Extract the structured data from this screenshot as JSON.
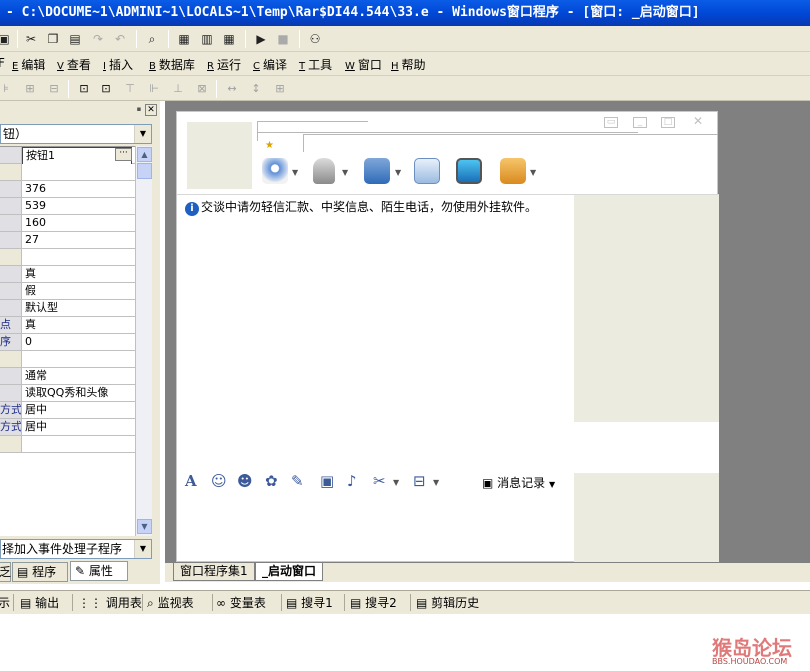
{
  "window": {
    "title": "- C:\\DOCUME~1\\ADMINI~1\\LOCALS~1\\Temp\\Rar$DI44.544\\33.e - Windows窗口程序 - [窗口: _启动窗口]"
  },
  "menu": [
    {
      "key": "E",
      "label": "编辑"
    },
    {
      "key": "V",
      "label": "查看"
    },
    {
      "key": "I",
      "label": "插入"
    },
    {
      "key": "B",
      "label": "数据库"
    },
    {
      "key": "R",
      "label": "运行"
    },
    {
      "key": "C",
      "label": "编译"
    },
    {
      "key": "T",
      "label": "工具"
    },
    {
      "key": "W",
      "label": "窗口"
    },
    {
      "key": "H",
      "label": "帮助"
    }
  ],
  "properties": {
    "combo_value": "钮）",
    "rows": [
      {
        "key": "",
        "value": "按钮1"
      },
      {
        "key": "",
        "value": ""
      },
      {
        "key": "",
        "value": "376"
      },
      {
        "key": "",
        "value": "539"
      },
      {
        "key": "",
        "value": "160"
      },
      {
        "key": "",
        "value": "27"
      },
      {
        "key": "",
        "value": ""
      },
      {
        "key": "",
        "value": "真"
      },
      {
        "key": "",
        "value": "假"
      },
      {
        "key": "",
        "value": "默认型"
      },
      {
        "key": "点",
        "value": "真"
      },
      {
        "key": "序",
        "value": "0"
      },
      {
        "key": "",
        "value": ""
      },
      {
        "key": "",
        "value": "通常"
      },
      {
        "key": "",
        "value": "读取QQ秀和头像"
      },
      {
        "key": "方式",
        "value": "居中"
      },
      {
        "key": "方式",
        "value": "居中"
      },
      {
        "key": "",
        "value": ""
      }
    ],
    "event_combo": "择加入事件处理子程序",
    "tabs": [
      "乏",
      "程序",
      "属性"
    ]
  },
  "qq": {
    "tip": "交谈中请勿轻信汇款、中奖信息、陌生电话，勿使用外挂软件。",
    "message_record": "消息记录"
  },
  "doc_tabs": [
    "窗口程序集1",
    "_启动窗口"
  ],
  "output_tabs": [
    "示",
    "输出",
    "调用表",
    "监视表",
    "变量表",
    "搜寻1",
    "搜寻2",
    "剪辑历史"
  ],
  "watermark": {
    "main": "猴岛论坛",
    "sub": "BBS.HOUDAO.COM"
  }
}
